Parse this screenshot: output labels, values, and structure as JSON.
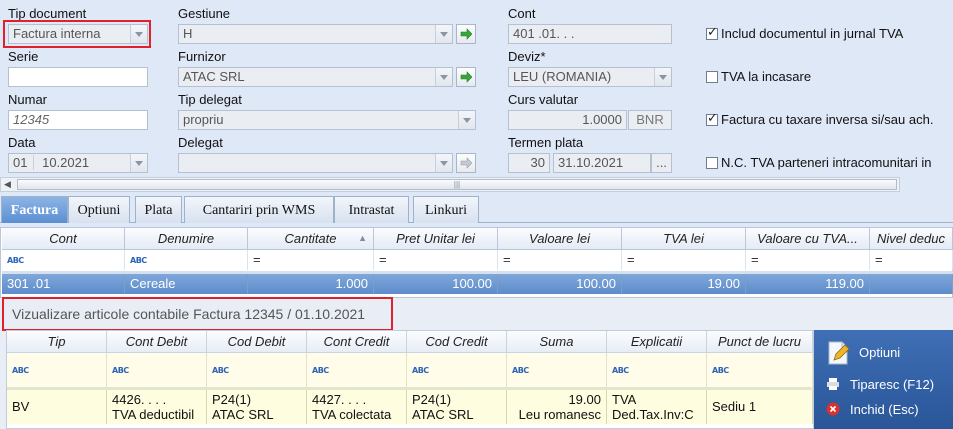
{
  "doc": {
    "tip_document": {
      "label": "Tip document",
      "value": "Factura interna"
    },
    "serie": {
      "label": "Serie",
      "value": ""
    },
    "numar": {
      "label": "Numar",
      "value": "12345"
    },
    "data": {
      "label": "Data",
      "day": "01",
      "rest": "10.2021"
    }
  },
  "gestiune": {
    "label": "Gestiune",
    "value": "H"
  },
  "furnizor": {
    "label": "Furnizor",
    "value": "ATAC SRL"
  },
  "tip_delegat": {
    "label": "Tip delegat",
    "value": "propriu"
  },
  "delegat": {
    "label": "Delegat",
    "value": ""
  },
  "cont": {
    "label": "Cont",
    "value": "401 .01. .  ."
  },
  "deviz": {
    "label": "Deviz*",
    "value": "LEU (ROMANIA)"
  },
  "curs": {
    "label": "Curs valutar",
    "value": "1.0000",
    "btn": "BNR"
  },
  "termen": {
    "label": "Termen plata",
    "days": "30",
    "date": "31.10.2021",
    "btn": "..."
  },
  "checks": [
    {
      "label": "Includ documentul in jurnal TVA",
      "checked": true
    },
    {
      "label": "TVA la incasare",
      "checked": false
    },
    {
      "label": "Factura cu taxare inversa si/sau ach.",
      "checked": true
    },
    {
      "label": "N.C. TVA parteneri intracomunitari in",
      "checked": false
    }
  ],
  "scroll_grip": "|||",
  "tabs": [
    "Factura",
    "Optiuni",
    "Plata",
    "Cantariri prin WMS",
    "Intrastat",
    "Linkuri"
  ],
  "grid": {
    "columns": [
      "Cont",
      "Denumire",
      "Cantitate",
      "Pret Unitar lei",
      "Valoare lei",
      "TVA lei",
      "Valoare cu TVA...",
      "Nivel deduc"
    ],
    "filter_tag": "ABC",
    "filter_eq": "=",
    "row": [
      "301 .01",
      "Cereale",
      "1.000",
      "100.00",
      "100.00",
      "19.00",
      "119.00",
      ""
    ]
  },
  "preview": {
    "title": "Vizualizare articole contabile Factura 12345 / 01.10.2021",
    "columns": [
      "Tip",
      "Cont Debit",
      "Cod Debit",
      "Cont Credit",
      "Cod Credit",
      "Suma",
      "Explicatii",
      "Punct de lucru"
    ],
    "filter_tag": "ABC",
    "row": {
      "tip": "BV",
      "cont_debit": [
        "4426.  .  .  .",
        "TVA deductibil"
      ],
      "cod_debit": [
        "P24(1)",
        "ATAC SRL"
      ],
      "cont_credit": [
        "4427.  .  .  .",
        "TVA colectata"
      ],
      "cod_credit": [
        "P24(1)",
        "ATAC SRL"
      ],
      "suma": [
        "19.00",
        "Leu romanesc"
      ],
      "explicatii": [
        "TVA",
        "Ded.Tax.Inv:C"
      ],
      "punct": "Sediu 1"
    },
    "buttons": {
      "optiuni": "Optiuni",
      "tiparesc": "Tiparesc (F12)",
      "inchid": "Inchid (Esc)"
    }
  }
}
